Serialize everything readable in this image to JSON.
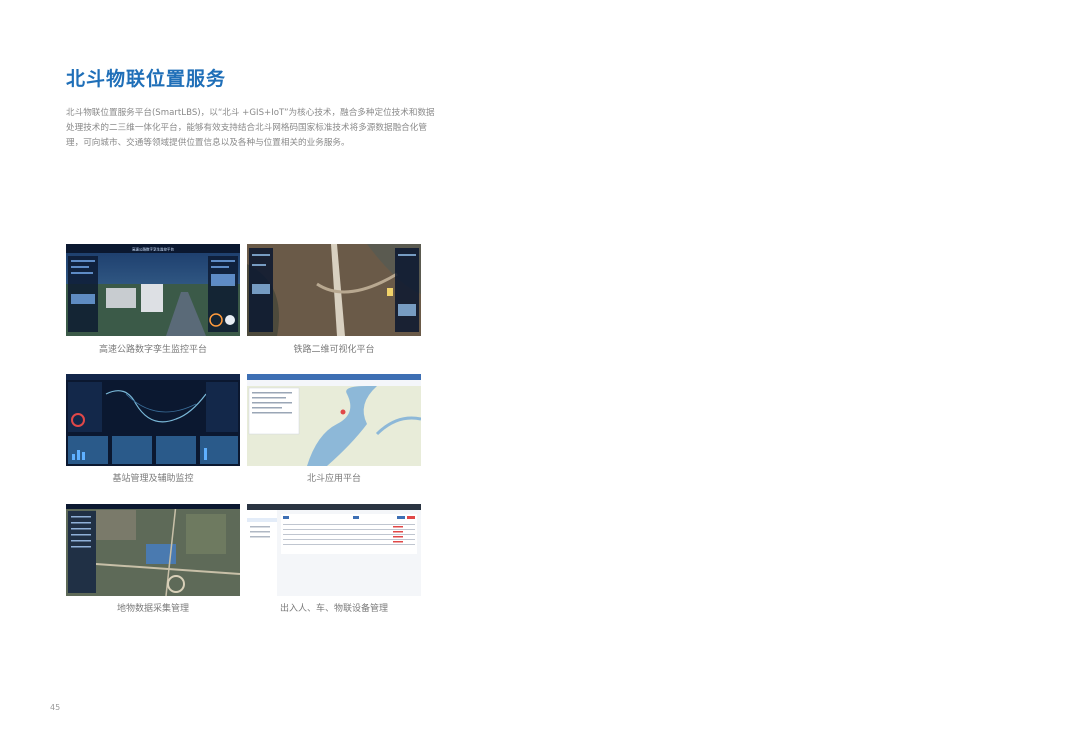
{
  "page": {
    "title": "北斗物联位置服务",
    "intro": "北斗物联位置服务平台(SmartLBS)，以“北斗 +GIS+IoT”为核心技术，融合多种定位技术和数据处理技术的二三维一体化平台，能够有效支持结合北斗网格码国家标准技术将多源数据融合化管理，可向城市、交通等领域提供位置信息以及各种与位置相关的业务服务。",
    "page_number": "45"
  },
  "screenshots": [
    {
      "caption": "高速公路数字孪生监控平台",
      "header": "高速公路数字孪生监控平台"
    },
    {
      "caption": "铁路二维可视化平台"
    },
    {
      "caption": "基站管理及辅助监控"
    },
    {
      "caption": "北斗应用平台"
    },
    {
      "caption": "地物数据采集管理"
    },
    {
      "caption": "出入人、车、物联设备管理"
    }
  ],
  "colors": {
    "title": "#1f6fb8",
    "text": "#8a8a8a",
    "dark_ui": "#0b1830",
    "map_bg": "#e8ecd9"
  }
}
